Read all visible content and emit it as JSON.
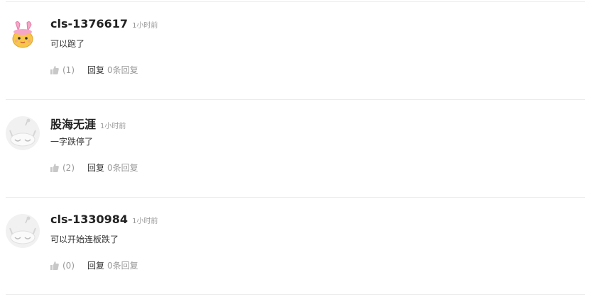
{
  "comments": [
    {
      "user": "cls-1376617",
      "time": "1小时前",
      "text": "可以跑了",
      "likes": "(1)",
      "reply_label": "回复",
      "reply_count": "0条回复",
      "avatar": "cat-cartoon-avatar"
    },
    {
      "user": "股海无涯",
      "time": "1小时前",
      "text": "一字跌停了",
      "likes": "(2)",
      "reply_label": "回复",
      "reply_count": "0条回复",
      "avatar": "default-sleepy-avatar"
    },
    {
      "user": "cls-1330984",
      "time": "1小时前",
      "text": "可以开始连板跌了",
      "likes": "(0)",
      "reply_label": "回复",
      "reply_count": "0条回复",
      "avatar": "default-sleepy-avatar"
    }
  ],
  "colors": {
    "divider": "#ececec",
    "muted": "#999999",
    "text": "#333333",
    "name": "#222222"
  }
}
